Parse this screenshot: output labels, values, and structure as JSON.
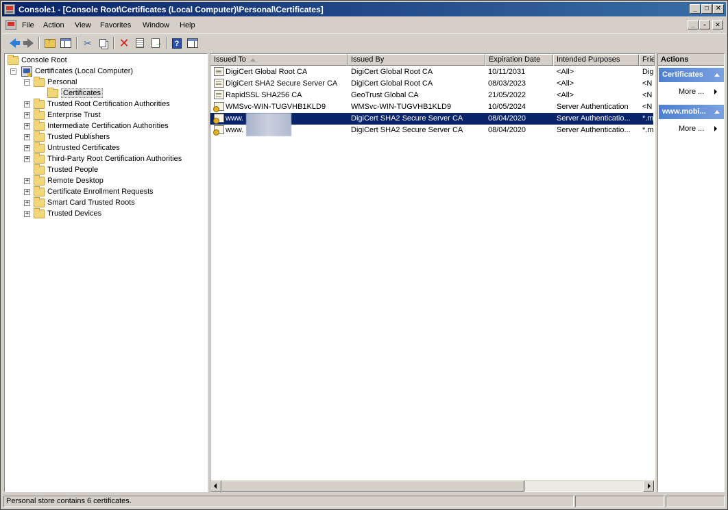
{
  "window": {
    "title": "Console1 - [Console Root\\Certificates (Local Computer)\\Personal\\Certificates]",
    "caption_buttons": [
      "_",
      "□",
      "✕"
    ],
    "mdi_buttons": [
      "_",
      "▫",
      "✕"
    ]
  },
  "menu": [
    "File",
    "Action",
    "View",
    "Favorites",
    "Window",
    "Help"
  ],
  "toolbar": {
    "icons": [
      "back-icon",
      "forward-icon",
      "up-one-level-icon",
      "show-hide-tree-icon",
      "cut-icon",
      "copy-icon",
      "delete-icon",
      "properties-icon",
      "export-list-icon",
      "help-icon",
      "show-hide-action-pane-icon"
    ],
    "help_glyph": "?"
  },
  "tree": {
    "root": "Console Root",
    "computer": "Certificates (Local Computer)",
    "personal": "Personal",
    "certificates": "Certificates",
    "stores": [
      "Trusted Root Certification Authorities",
      "Enterprise Trust",
      "Intermediate Certification Authorities",
      "Trusted Publishers",
      "Untrusted Certificates",
      "Third-Party Root Certification Authorities",
      "Trusted People",
      "Remote Desktop",
      "Certificate Enrollment Requests",
      "Smart Card Trusted Roots",
      "Trusted Devices"
    ],
    "expander_plus": "+",
    "expander_minus": "−"
  },
  "list": {
    "columns": [
      "Issued To",
      "Issued By",
      "Expiration Date",
      "Intended Purposes",
      "Frie"
    ],
    "rows": [
      {
        "issued_to": "DigiCert Global Root CA",
        "issued_by": "DigiCert Global Root CA",
        "expiration": "10/11/2031",
        "purposes": "<All>",
        "friendly": "Dig",
        "icon": "certificate-icon"
      },
      {
        "issued_to": "DigiCert SHA2 Secure Server CA",
        "issued_by": "DigiCert Global Root CA",
        "expiration": "08/03/2023",
        "purposes": "<All>",
        "friendly": "<N",
        "icon": "certificate-icon"
      },
      {
        "issued_to": "RapidSSL SHA256 CA",
        "issued_by": "GeoTrust Global CA",
        "expiration": "21/05/2022",
        "purposes": "<All>",
        "friendly": "<N",
        "icon": "certificate-icon"
      },
      {
        "issued_to": "WMSvc-WIN-TUGVHB1KLD9",
        "issued_by": "WMSvc-WIN-TUGVHB1KLD9",
        "expiration": "10/05/2024",
        "purposes": "Server Authentication",
        "friendly": "<N",
        "icon": "certificate-key-icon"
      },
      {
        "issued_to": "www.",
        "issued_by": "DigiCert SHA2 Secure Server CA",
        "expiration": "08/04/2020",
        "purposes": "Server Authenticatio...",
        "friendly": "*.m",
        "icon": "certificate-key-icon",
        "selected": true
      },
      {
        "issued_to": "www.",
        "issued_by": "DigiCert SHA2 Secure Server CA",
        "expiration": "08/04/2020",
        "purposes": "Server Authenticatio...",
        "friendly": "*.m",
        "icon": "certificate-key-icon"
      }
    ]
  },
  "actions": {
    "header": "Actions",
    "sections": [
      {
        "title": "Certificates",
        "item": "More ..."
      },
      {
        "title": "www.mobi...",
        "item": "More ..."
      }
    ]
  },
  "status": {
    "text": "Personal store contains 6 certificates."
  },
  "colors": {
    "selection": "#0a246a",
    "title_gradient_start": "#0a246a",
    "title_gradient_end": "#3a6ea5",
    "action_section": "#4e7fd0"
  }
}
